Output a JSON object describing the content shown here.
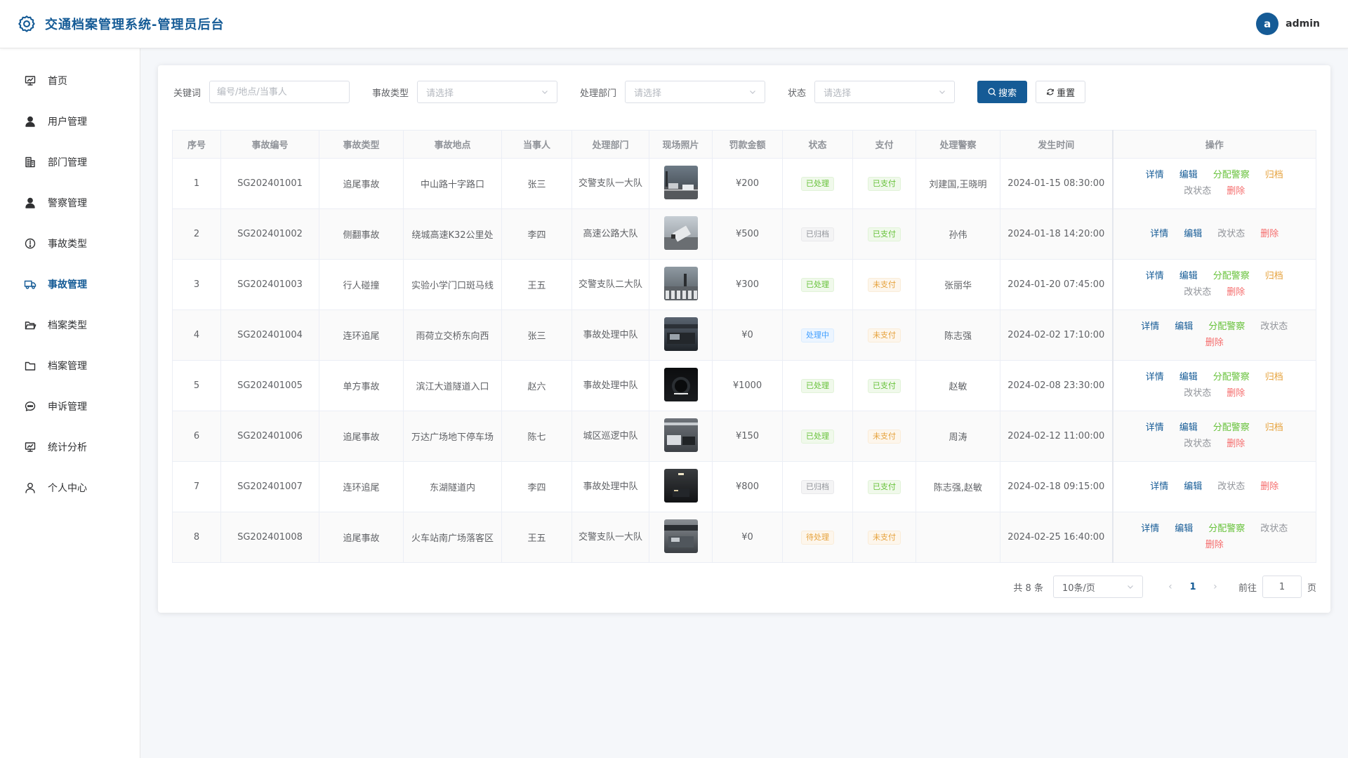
{
  "app": {
    "title": "交通档案管理系统-管理员后台"
  },
  "user": {
    "avatar_letter": "a",
    "name": "admin"
  },
  "sidebar": {
    "items": [
      {
        "label": "首页",
        "icon": "monitor-icon",
        "active": false
      },
      {
        "label": "用户管理",
        "icon": "user-solid-icon",
        "active": false
      },
      {
        "label": "部门管理",
        "icon": "office-building-icon",
        "active": false
      },
      {
        "label": "警察管理",
        "icon": "avatar-icon",
        "active": false
      },
      {
        "label": "事故类型",
        "icon": "warning-circle-icon",
        "active": false
      },
      {
        "label": "事故管理",
        "icon": "van-icon",
        "active": true
      },
      {
        "label": "档案类型",
        "icon": "folder-opened-icon",
        "active": false
      },
      {
        "label": "档案管理",
        "icon": "folder-icon",
        "active": false
      },
      {
        "label": "申诉管理",
        "icon": "chat-dot-icon",
        "active": false
      },
      {
        "label": "统计分析",
        "icon": "monitor-icon",
        "active": false
      },
      {
        "label": "个人中心",
        "icon": "user-outline-icon",
        "active": false
      }
    ]
  },
  "filters": {
    "keyword_label": "关键词",
    "keyword_value": "",
    "keyword_placeholder": "编号/地点/当事人",
    "type_label": "事故类型",
    "type_placeholder": "请选择",
    "dept_label": "处理部门",
    "dept_placeholder": "请选择",
    "status_label": "状态",
    "status_placeholder": "请选择",
    "search_label": "搜索",
    "reset_label": "重置"
  },
  "table": {
    "headers": [
      "序号",
      "事故编号",
      "事故类型",
      "事故地点",
      "当事人",
      "处理部门",
      "现场照片",
      "罚款金额",
      "状态",
      "支付",
      "处理警察",
      "发生时间",
      "操作"
    ],
    "rows": [
      {
        "index": "1",
        "code": "SG202401001",
        "type": "追尾事故",
        "location": "中山路十字路口",
        "party": "张三",
        "dept": "交警支队一大队",
        "photo": "photo-intersection",
        "fine": "¥200",
        "status": "已处理",
        "status_color": "green",
        "pay": "已支付",
        "pay_color": "green",
        "police": "刘建国,王晓明",
        "time": "2024-01-15 08:30:00",
        "actions": [
          "详情",
          "编辑",
          "分配警察",
          "归档",
          "改状态",
          "删除"
        ]
      },
      {
        "index": "2",
        "code": "SG202401002",
        "type": "侧翻事故",
        "location": "绕城高速K32公里处",
        "party": "李四",
        "dept": "高速公路大队",
        "photo": "photo-highway",
        "fine": "¥500",
        "status": "已归档",
        "status_color": "gray",
        "pay": "已支付",
        "pay_color": "green",
        "police": "孙伟",
        "time": "2024-01-18 14:20:00",
        "actions": [
          "详情",
          "编辑",
          "改状态",
          "删除"
        ]
      },
      {
        "index": "3",
        "code": "SG202401003",
        "type": "行人碰撞",
        "location": "实验小学门口斑马线",
        "party": "王五",
        "dept": "交警支队二大队",
        "photo": "photo-crosswalk",
        "fine": "¥300",
        "status": "已处理",
        "status_color": "green",
        "pay": "未支付",
        "pay_color": "orange",
        "police": "张丽华",
        "time": "2024-01-20 07:45:00",
        "actions": [
          "详情",
          "编辑",
          "分配警察",
          "归档",
          "改状态",
          "删除"
        ]
      },
      {
        "index": "4",
        "code": "SG202401004",
        "type": "连环追尾",
        "location": "雨荷立交桥东向西",
        "party": "张三",
        "dept": "事故处理中队",
        "photo": "photo-overpass",
        "fine": "¥0",
        "status": "处理中",
        "status_color": "blue",
        "pay": "未支付",
        "pay_color": "orange",
        "police": "陈志强",
        "time": "2024-02-02 17:10:00",
        "actions": [
          "详情",
          "编辑",
          "分配警察",
          "改状态",
          "删除"
        ]
      },
      {
        "index": "5",
        "code": "SG202401005",
        "type": "单方事故",
        "location": "滨江大道隧道入口",
        "party": "赵六",
        "dept": "事故处理中队",
        "photo": "photo-tunnel-entrance",
        "fine": "¥1000",
        "status": "已处理",
        "status_color": "green",
        "pay": "已支付",
        "pay_color": "green",
        "police": "赵敏",
        "time": "2024-02-08 23:30:00",
        "actions": [
          "详情",
          "编辑",
          "分配警察",
          "归档",
          "改状态",
          "删除"
        ]
      },
      {
        "index": "6",
        "code": "SG202401006",
        "type": "追尾事故",
        "location": "万达广场地下停车场",
        "party": "陈七",
        "dept": "城区巡逻中队",
        "photo": "photo-parking",
        "fine": "¥150",
        "status": "已处理",
        "status_color": "green",
        "pay": "未支付",
        "pay_color": "orange",
        "police": "周涛",
        "time": "2024-02-12 11:00:00",
        "actions": [
          "详情",
          "编辑",
          "分配警察",
          "归档",
          "改状态",
          "删除"
        ]
      },
      {
        "index": "7",
        "code": "SG202401007",
        "type": "连环追尾",
        "location": "东湖隧道内",
        "party": "李四",
        "dept": "事故处理中队",
        "photo": "photo-tunnel",
        "fine": "¥800",
        "status": "已归档",
        "status_color": "gray",
        "pay": "已支付",
        "pay_color": "green",
        "police": "陈志强,赵敏",
        "time": "2024-02-18 09:15:00",
        "actions": [
          "详情",
          "编辑",
          "改状态",
          "删除"
        ]
      },
      {
        "index": "8",
        "code": "SG202401008",
        "type": "追尾事故",
        "location": "火车站南广场落客区",
        "party": "王五",
        "dept": "交警支队一大队",
        "photo": "photo-station",
        "fine": "¥0",
        "status": "待处理",
        "status_color": "orange",
        "pay": "未支付",
        "pay_color": "orange",
        "police": "",
        "time": "2024-02-25 16:40:00",
        "actions": [
          "详情",
          "编辑",
          "分配警察",
          "改状态",
          "删除"
        ]
      }
    ]
  },
  "pagination": {
    "total_text": "共 8 条",
    "page_size": "10条/页",
    "current_page": "1",
    "goto_label": "前往",
    "goto_value": "1",
    "page_suffix": "页"
  },
  "colors": {
    "primary": "#155b96",
    "success": "#67c23a",
    "warning": "#e6a23c",
    "danger": "#f56c6c",
    "info": "#909399"
  }
}
